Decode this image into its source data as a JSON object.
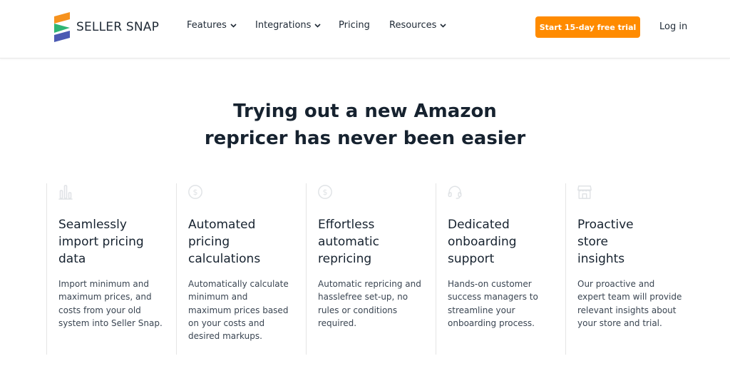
{
  "brand": {
    "name": "SELLER SNAP"
  },
  "nav": {
    "items": [
      {
        "label": "Features",
        "dropdown": true
      },
      {
        "label": "Integrations",
        "dropdown": true
      },
      {
        "label": "Pricing",
        "dropdown": false
      },
      {
        "label": "Resources",
        "dropdown": true
      }
    ],
    "cta": "Start 15-day free trial",
    "login": "Log in"
  },
  "hero": {
    "lines": [
      "Trying out a new Amazon",
      "repricer has never been easier"
    ]
  },
  "features": [
    {
      "icon": "bar-chart-icon",
      "title": [
        "Seamlessly",
        "import pricing",
        "data"
      ],
      "body": [
        "Import minimum and",
        "maximum prices, and",
        "costs from your old",
        "system into Seller Snap."
      ]
    },
    {
      "icon": "dollar-coin-icon",
      "title": [
        "Automated",
        "pricing",
        "calculations"
      ],
      "body": [
        "Automatically calculate",
        "minimum and",
        "maximum prices based",
        "on your costs and",
        "desired markups."
      ]
    },
    {
      "icon": "dollar-coin-icon",
      "title": [
        "Effortless",
        "automatic",
        "repricing"
      ],
      "body": [
        "Automatic repricing and",
        "hasslefree set-up, no",
        "rules or conditions",
        "required."
      ]
    },
    {
      "icon": "headset-icon",
      "title": [
        "Dedicated",
        "onboarding",
        "support"
      ],
      "body": [
        "Hands-on customer",
        "success managers to",
        "streamline your",
        "onboarding process."
      ]
    },
    {
      "icon": "storefront-icon",
      "title": [
        "Proactive",
        "store",
        "insights"
      ],
      "body": [
        "Our proactive and",
        "expert team will provide",
        "relevant insights about",
        "your store and trial."
      ]
    }
  ],
  "colors": {
    "accent": "#ff8b00",
    "text_dark": "#16222f",
    "icon_muted": "#e0e3e6",
    "logo_orange": "#f6921e",
    "logo_green": "#2fb574",
    "logo_blue": "#4b5ab3"
  }
}
